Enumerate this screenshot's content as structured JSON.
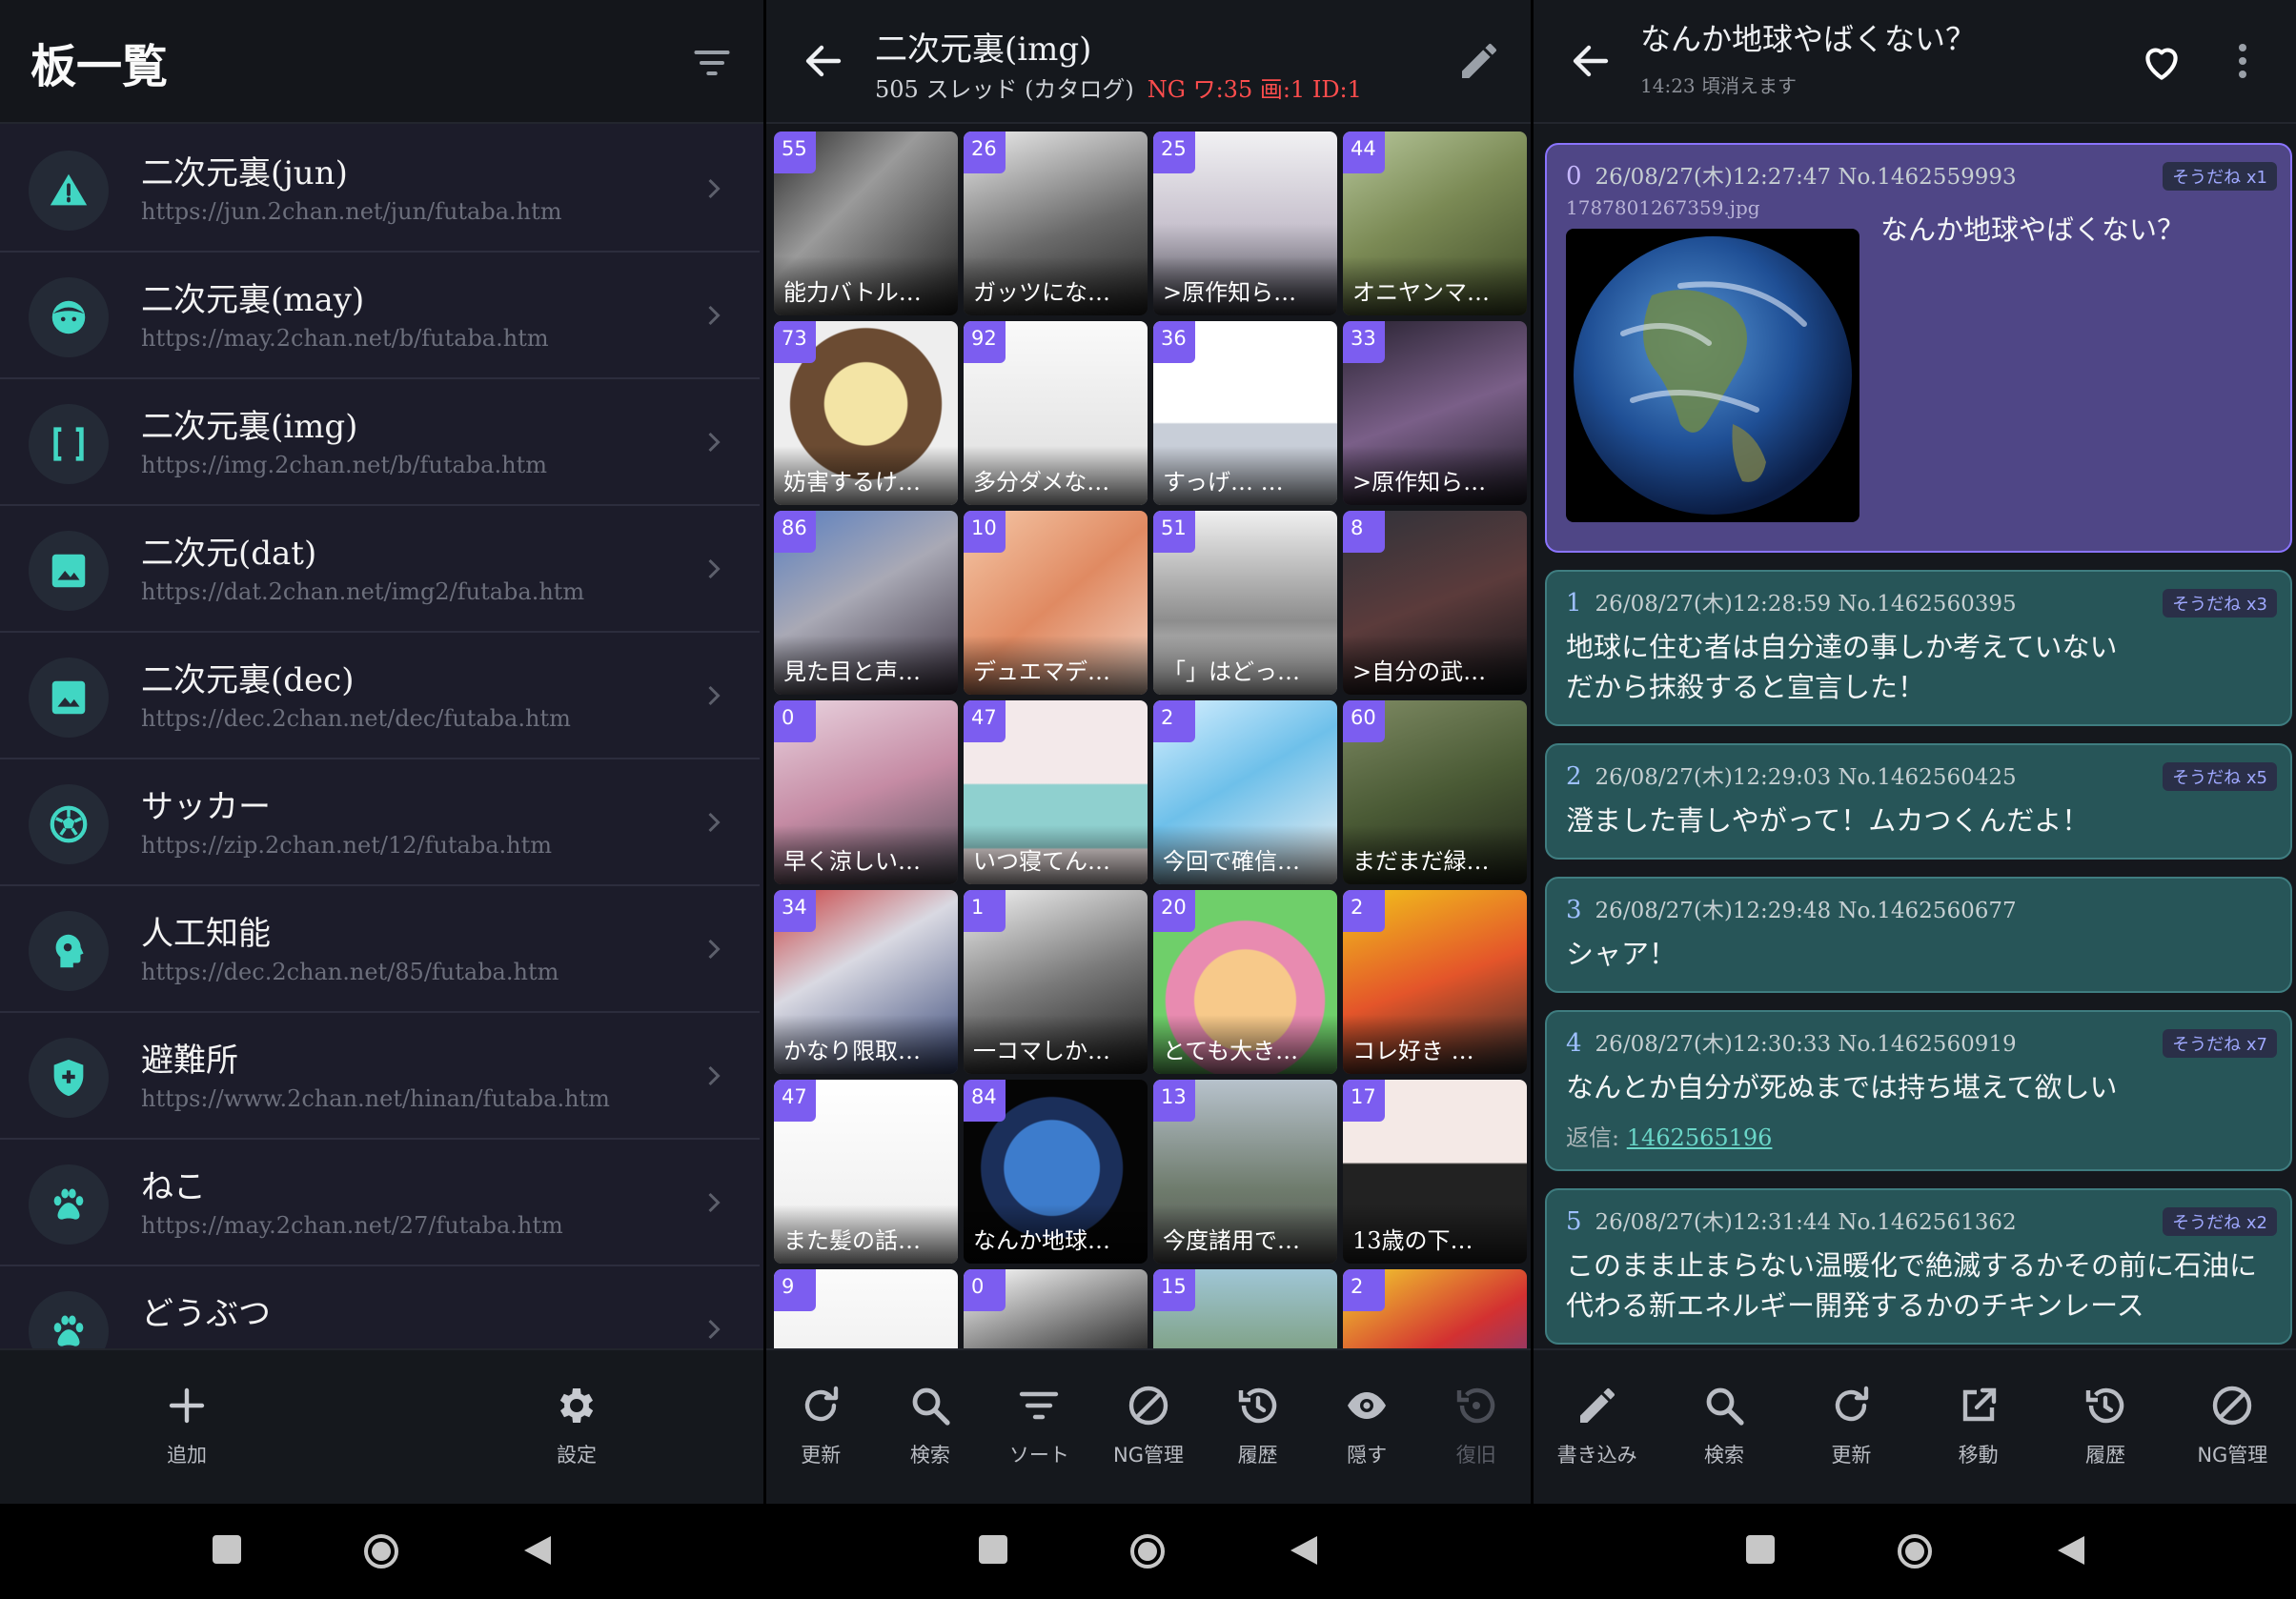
{
  "colors": {
    "accent": "#41d6c3",
    "ng": "#ff4d4d",
    "count_badge": "#7c5df0",
    "op_bg": "#4f4686",
    "post_bg": "#275558"
  },
  "panel1": {
    "title": "板一覧",
    "boards": [
      {
        "name": "二次元裏(jun)",
        "url": "https://jun.2chan.net/jun/futaba.htm",
        "icon": "warning-icon"
      },
      {
        "name": "二次元裏(may)",
        "url": "https://may.2chan.net/b/futaba.htm",
        "icon": "face-icon"
      },
      {
        "name": "二次元裏(img)",
        "url": "https://img.2chan.net/b/futaba.htm",
        "icon": "brackets-icon"
      },
      {
        "name": "二次元(dat)",
        "url": "https://dat.2chan.net/img2/futaba.htm",
        "icon": "image-icon"
      },
      {
        "name": "二次元裏(dec)",
        "url": "https://dec.2chan.net/dec/futaba.htm",
        "icon": "image-icon"
      },
      {
        "name": "サッカー",
        "url": "https://zip.2chan.net/12/futaba.htm",
        "icon": "soccer-ball-icon"
      },
      {
        "name": "人工知能",
        "url": "https://dec.2chan.net/85/futaba.htm",
        "icon": "ai-head-icon"
      },
      {
        "name": "避難所",
        "url": "https://www.2chan.net/hinan/futaba.htm",
        "icon": "shield-plus-icon"
      },
      {
        "name": "ねこ",
        "url": "https://may.2chan.net/27/futaba.htm",
        "icon": "paw-icon"
      },
      {
        "name": "どうぶつ",
        "url": "",
        "icon": "paw-icon"
      }
    ],
    "actions": {
      "add": "追加",
      "settings": "設定"
    }
  },
  "panel2": {
    "title": "二次元裏(img)",
    "subtitle": "505 スレッド (カタログ)",
    "ng_status": "NG ワ:35 画:1 ID:1",
    "threads": [
      {
        "count": "55",
        "caption": "能力バトル…"
      },
      {
        "count": "26",
        "caption": "ガッツにな…"
      },
      {
        "count": "25",
        "caption": ">原作知ら…"
      },
      {
        "count": "44",
        "caption": "オニヤンマ…"
      },
      {
        "count": "73",
        "caption": "妨害するけ…"
      },
      {
        "count": "92",
        "caption": "多分ダメな…"
      },
      {
        "count": "36",
        "caption": "すっげ… …"
      },
      {
        "count": "33",
        "caption": ">原作知ら…"
      },
      {
        "count": "86",
        "caption": "見た目と声…"
      },
      {
        "count": "10",
        "caption": "デュエマデ…"
      },
      {
        "count": "51",
        "caption": "「」はどっ…"
      },
      {
        "count": "8",
        "caption": ">自分の武…"
      },
      {
        "count": "0",
        "caption": "早く涼しい…"
      },
      {
        "count": "47",
        "caption": "いつ寝てん…"
      },
      {
        "count": "2",
        "caption": "今回で確信…"
      },
      {
        "count": "60",
        "caption": "まだまだ緑…"
      },
      {
        "count": "34",
        "caption": "かなり限取…"
      },
      {
        "count": "1",
        "caption": "一コマしか…"
      },
      {
        "count": "20",
        "caption": "とても大き…"
      },
      {
        "count": "2",
        "caption": "コレ好き …"
      },
      {
        "count": "47",
        "caption": "また髪の話…"
      },
      {
        "count": "84",
        "caption": "なんか地球…"
      },
      {
        "count": "13",
        "caption": "今度諸用で…"
      },
      {
        "count": "17",
        "caption": "13歳の下…"
      },
      {
        "count": "9",
        "caption": ""
      },
      {
        "count": "0",
        "caption": ""
      },
      {
        "count": "15",
        "caption": ""
      },
      {
        "count": "2",
        "caption": ""
      }
    ],
    "actions": [
      "更新",
      "検索",
      "ソート",
      "NG管理",
      "履歴",
      "隠す",
      "復旧"
    ]
  },
  "panel3": {
    "title": "なんか地球やばくない？",
    "subtitle": "14:23 頃消えます",
    "op": {
      "num": "0",
      "meta": "26/08/27(木)12:27:47 No.1462559993",
      "sodane": "そうだね x1",
      "filename": "1787801267359.jpg",
      "text": "なんか地球やばくない？"
    },
    "reply_label": "返信:",
    "posts": [
      {
        "num": "1",
        "meta": "26/08/27(木)12:28:59 No.1462560395",
        "sodane": "そうだね x3",
        "text": "地球に住む者は自分達の事しか考えていない\nだから抹殺すると宣言した！",
        "reply": ""
      },
      {
        "num": "2",
        "meta": "26/08/27(木)12:29:03 No.1462560425",
        "sodane": "そうだね x5",
        "text": "澄ました青しやがって！ムカつくんだよ！",
        "reply": ""
      },
      {
        "num": "3",
        "meta": "26/08/27(木)12:29:48 No.1462560677",
        "sodane": "",
        "text": "シャア！",
        "reply": ""
      },
      {
        "num": "4",
        "meta": "26/08/27(木)12:30:33 No.1462560919",
        "sodane": "そうだね x7",
        "text": "なんとか自分が死ぬまでは持ち堪えて欲しい",
        "reply": "1462565196"
      },
      {
        "num": "5",
        "meta": "26/08/27(木)12:31:44 No.1462561362",
        "sodane": "そうだね x2",
        "text": "このまま止まらない温暖化で絶滅するかその前に石油に\n代わる新エネルギー開発するかのチキンレース",
        "reply": ""
      }
    ],
    "actions": [
      "書き込み",
      "検索",
      "更新",
      "移動",
      "履歴",
      "NG管理"
    ]
  }
}
